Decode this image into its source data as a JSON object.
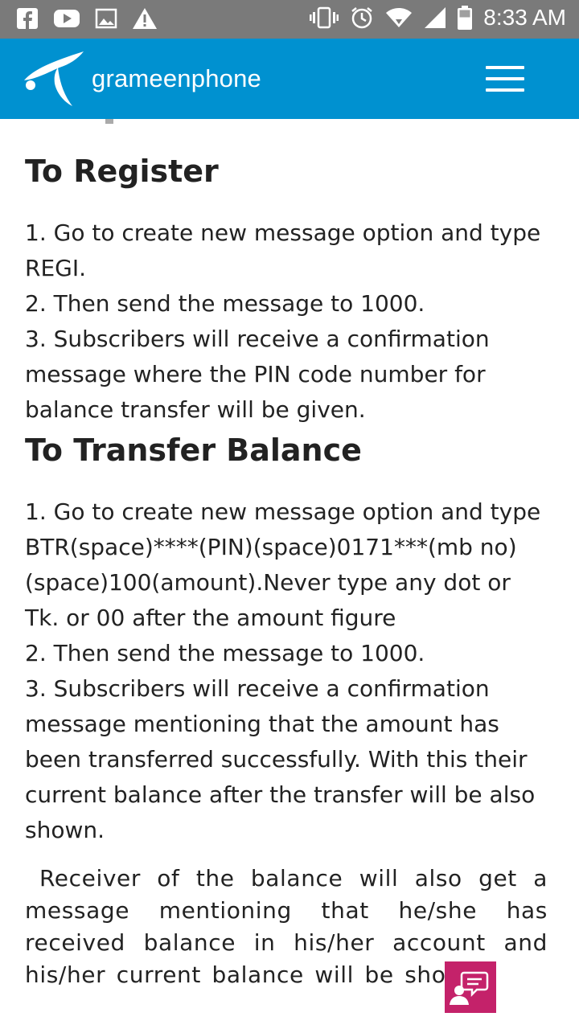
{
  "status_bar": {
    "time": "8:33 AM",
    "icons": [
      "facebook-icon",
      "youtube-icon",
      "gallery-icon",
      "warning-icon",
      "vibrate-icon",
      "alarm-icon",
      "wifi-icon",
      "signal-icon",
      "battery-icon"
    ]
  },
  "header": {
    "brand": "grameenphone",
    "menu_icon": "hamburger-menu-icon",
    "color": "#0091d0"
  },
  "sections": {
    "register": {
      "title": "To Register",
      "steps": [
        "1. Go to create new message option and type REGI.",
        "2. Then send the message to 1000.",
        "3. Subscribers will receive a confirmation message where the PIN code number for balance transfer will be given."
      ]
    },
    "transfer": {
      "title": "To Transfer Balance",
      "steps": [
        "1. Go to create new message option and type BTR(space)****(PIN)(space)0171***(mb no)(space)100(amount).Never type any dot or Tk. or 00 after the amount figure",
        "2. Then send the message to 1000.",
        "3. Subscribers will receive a confirmation message mentioning that the amount has been transferred successfully. With this their current balance after the transfer will be also shown."
      ]
    },
    "receiver_note": "Receiver of the balance will also get a message mentioning that he/she has received balance in his/her account and his/her current balance will be shown."
  },
  "chat_button": {
    "icon": "chat-icon",
    "color": "#c4226a"
  }
}
